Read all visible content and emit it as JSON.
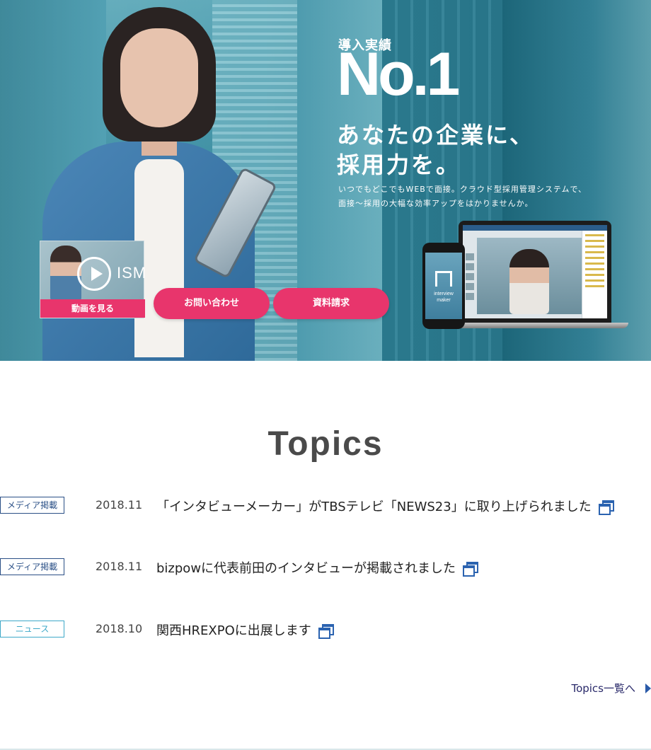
{
  "hero": {
    "badge_label": "導入実績",
    "badge_value": "No.1",
    "headline_line1": "あなたの企業に、",
    "headline_line2": "採用力を。",
    "lead_line1": "いつでもどこでもWEBで面接。クラウド型採用管理システムで、",
    "lead_line2": "面接～採用の大幅な効率アップをはかりませんか。",
    "video_logo": "ISM",
    "video_button": "動画を見る",
    "contact_button": "お問い合わせ",
    "docs_button": "資料請求",
    "phone_app_name_line1": "interview",
    "phone_app_name_line2": "maker"
  },
  "topics": {
    "title": "Topics",
    "items": [
      {
        "tag": "メディア掲載",
        "date": "2018.11",
        "title": "「インタビューメーカー」がTBSテレビ「NEWS23」に取り上げられました"
      },
      {
        "tag": "メディア掲載",
        "date": "2018.11",
        "title": "bizpowに代表前田のインタビューが掲載されました"
      },
      {
        "tag": "ニュース",
        "date": "2018.10",
        "title": "関西HREXPOに出展します"
      }
    ],
    "more_link": "Topics一覧へ"
  },
  "colors": {
    "accent_pink": "#e8356c",
    "tag_media": "#2a4f86",
    "tag_news": "#3ea8c8",
    "link_icon": "#2b63b0"
  }
}
